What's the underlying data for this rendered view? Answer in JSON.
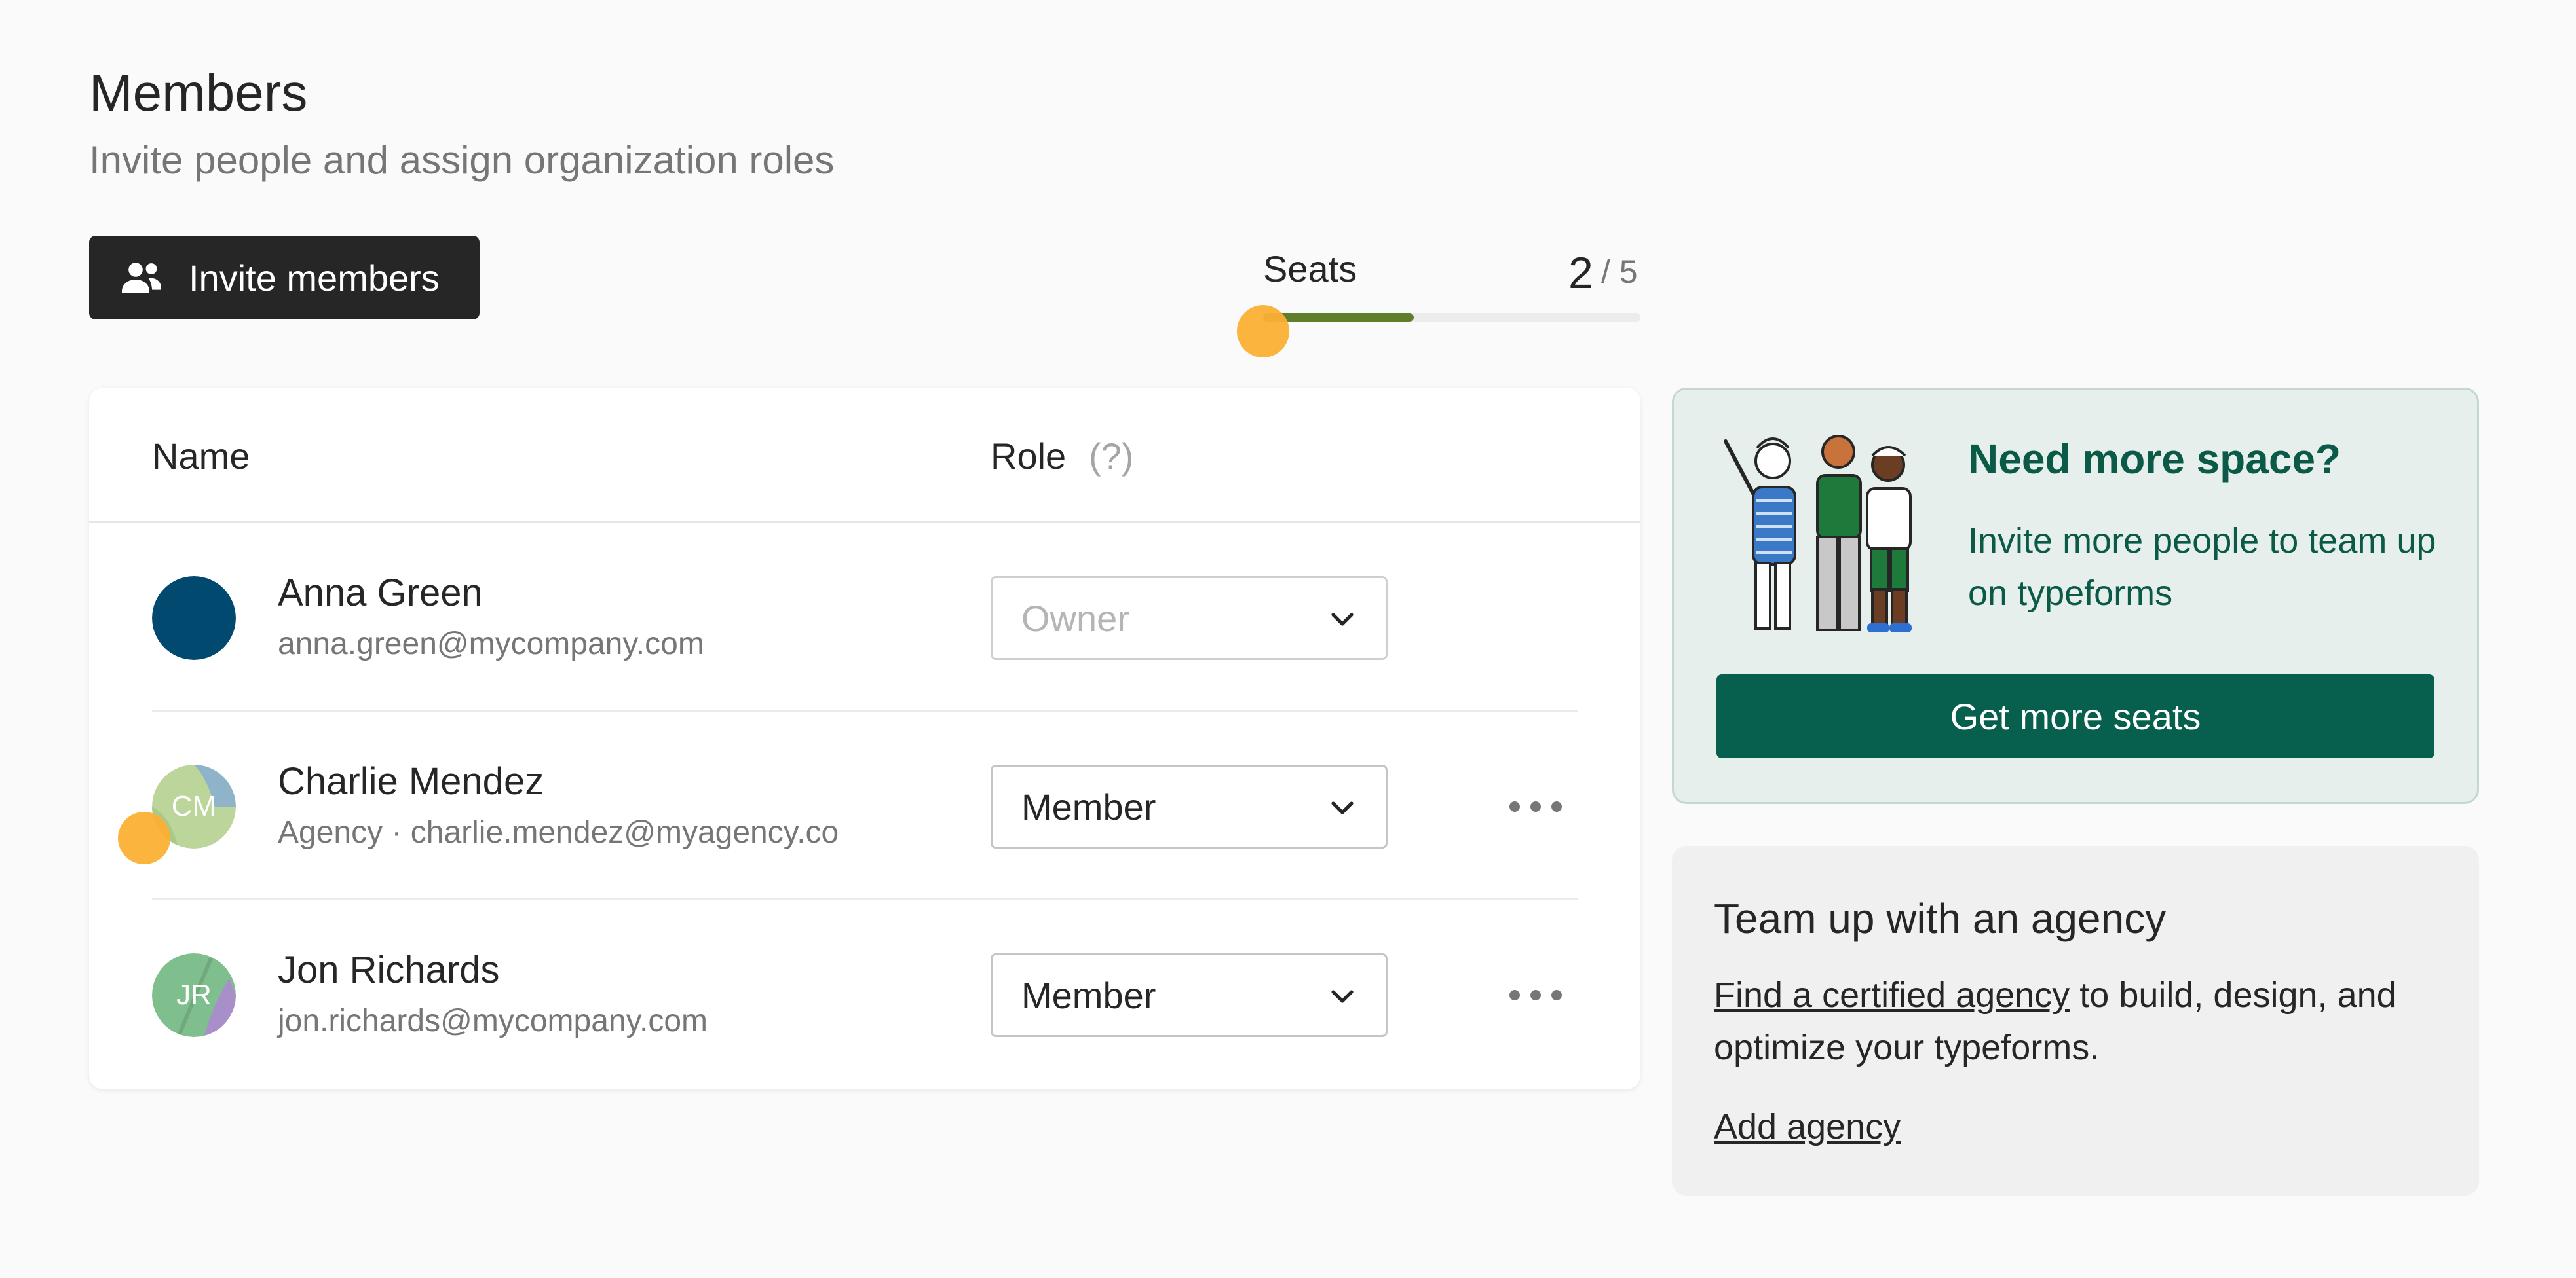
{
  "header": {
    "title": "Members",
    "subtitle": "Invite people and assign organization roles",
    "invite_button": "Invite members"
  },
  "seats": {
    "label": "Seats",
    "used": "2",
    "total": "/ 5",
    "used_fraction": 0.4
  },
  "table": {
    "col_name": "Name",
    "col_role": "Role",
    "role_help": "(?)",
    "members": [
      {
        "name": "Anna Green",
        "sub": "anna.green@mycompany.com",
        "initials": "",
        "role": "Owner",
        "role_disabled": true,
        "avatar_color": "#02496f"
      },
      {
        "name": "Charlie Mendez",
        "sub": "Agency · charlie.mendez@myagency.co",
        "initials": "CM",
        "role": "Member",
        "role_disabled": false,
        "avatar_color": "#bcd59a"
      },
      {
        "name": "Jon Richards",
        "sub": "jon.richards@mycompany.com",
        "initials": "JR",
        "role": "Member",
        "role_disabled": false,
        "avatar_color": "#7fbf8e"
      }
    ]
  },
  "promo": {
    "title": "Need more space?",
    "text": "Invite more people to team up on typeforms",
    "button": "Get more seats",
    "illustration": "three-people-illustration"
  },
  "agency": {
    "title": "Team up with an agency",
    "link_text": "Find a certified agency",
    "text_rest": " to build, design, and optimize your typeforms.",
    "add_link": "Add agency"
  },
  "colors": {
    "dark_button": "#262627",
    "seats_fill": "#5f7e2b",
    "promo_green": "#06604d",
    "cursor": "#fbb033"
  },
  "icons": {
    "invite": "people-add-icon",
    "chevron": "chevron-down-icon",
    "more": "more-horizontal-icon"
  }
}
